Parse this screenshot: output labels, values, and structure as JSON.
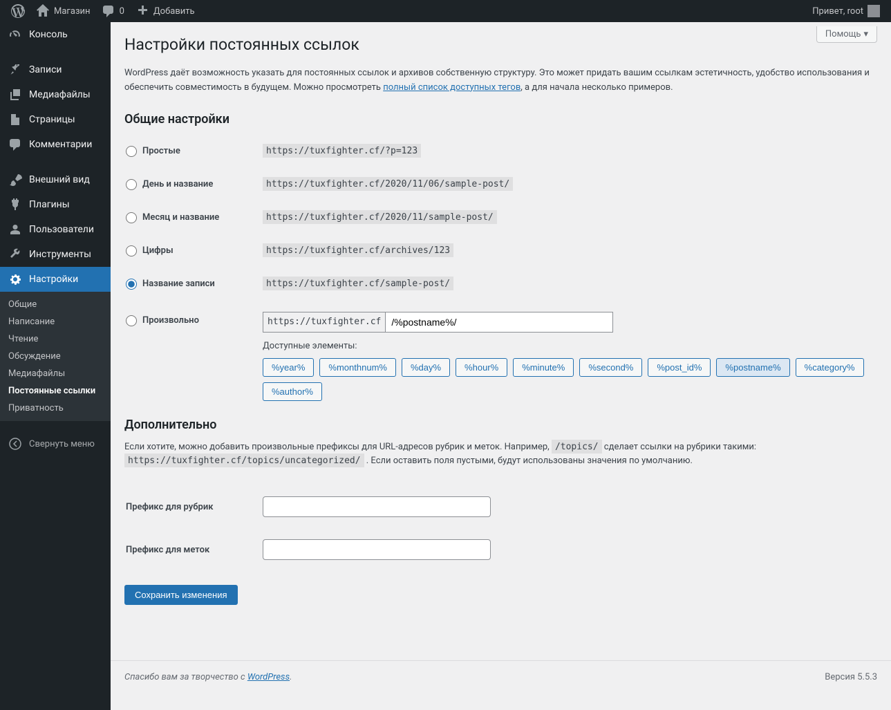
{
  "toolbar": {
    "site_name": "Магазин",
    "comments_count": "0",
    "add_new": "Добавить",
    "greeting": "Привет, root"
  },
  "menu": {
    "dashboard": "Консоль",
    "posts": "Записи",
    "media": "Медиафайлы",
    "pages": "Страницы",
    "comments": "Комментарии",
    "appearance": "Внешний вид",
    "plugins": "Плагины",
    "users": "Пользователи",
    "tools": "Инструменты",
    "settings": "Настройки",
    "collapse": "Свернуть меню"
  },
  "submenu": {
    "general": "Общие",
    "writing": "Написание",
    "reading": "Чтение",
    "discussion": "Обсуждение",
    "media": "Медиафайлы",
    "permalinks": "Постоянные ссылки",
    "privacy": "Приватность"
  },
  "help_tab": "Помощь",
  "page_title": "Настройки постоянных ссылок",
  "intro_1": "WordPress даёт возможность указать для постоянных ссылок и архивов собственную структуру. Это может придать вашим ссылкам эстетичность, удобство использования и обеспечить совместимость в будущем. Можно просмотреть ",
  "intro_link": "полный список доступных тегов",
  "intro_2": ", а для начала несколько примеров.",
  "h2_common": "Общие настройки",
  "options": {
    "plain": {
      "label": "Простые",
      "example": "https://tuxfighter.cf/?p=123"
    },
    "dayname": {
      "label": "День и название",
      "example": "https://tuxfighter.cf/2020/11/06/sample-post/"
    },
    "monthname": {
      "label": "Месяц и название",
      "example": "https://tuxfighter.cf/2020/11/sample-post/"
    },
    "numeric": {
      "label": "Цифры",
      "example": "https://tuxfighter.cf/archives/123"
    },
    "postname": {
      "label": "Название записи",
      "example": "https://tuxfighter.cf/sample-post/"
    },
    "custom": {
      "label": "Произвольно",
      "prefix": "https://tuxfighter.cf",
      "value": "/%postname%/"
    }
  },
  "available_label": "Доступные элементы:",
  "tags": [
    "%year%",
    "%monthnum%",
    "%day%",
    "%hour%",
    "%minute%",
    "%second%",
    "%post_id%",
    "%postname%",
    "%category%",
    "%author%"
  ],
  "active_tag": "%postname%",
  "h2_optional": "Дополнительно",
  "optional_1": "Если хотите, можно добавить произвольные префиксы для URL-адресов рубрик и меток. Например, ",
  "optional_code1": "/topics/",
  "optional_2": " сделает ссылки на рубрики такими: ",
  "optional_code2": "https://tuxfighter.cf/topics/uncategorized/",
  "optional_3": " . Если оставить поля пустыми, будут использованы значения по умолчанию.",
  "category_base_label": "Префикс для рубрик",
  "tag_base_label": "Префикс для меток",
  "submit": "Сохранить изменения",
  "footer_thanks": "Спасибо вам за творчество с ",
  "footer_link": "WordPress",
  "footer_dot": ".",
  "version": "Версия 5.5.3"
}
